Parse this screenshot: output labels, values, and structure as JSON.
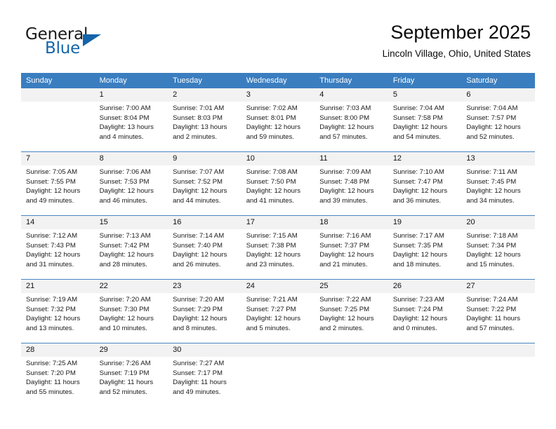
{
  "logo": {
    "word_one": "General",
    "word_two": "Blue",
    "icon": "triangle-logo-mark"
  },
  "header": {
    "month_title": "September 2025",
    "location": "Lincoln Village, Ohio, United States"
  },
  "colors": {
    "header_blue": "#3a7ec0",
    "row_divider": "#4a86c4",
    "daynum_band": "#f2f2f2",
    "logo_blue": "#1464aa"
  },
  "weekday_headers": [
    "Sunday",
    "Monday",
    "Tuesday",
    "Wednesday",
    "Thursday",
    "Friday",
    "Saturday"
  ],
  "weeks": [
    [
      {
        "day": "",
        "empty": true,
        "sunrise": "",
        "sunset": "",
        "daylight_line1": "",
        "daylight_line2": ""
      },
      {
        "day": "1",
        "sunrise": "Sunrise: 7:00 AM",
        "sunset": "Sunset: 8:04 PM",
        "daylight_line1": "Daylight: 13 hours",
        "daylight_line2": "and 4 minutes."
      },
      {
        "day": "2",
        "sunrise": "Sunrise: 7:01 AM",
        "sunset": "Sunset: 8:03 PM",
        "daylight_line1": "Daylight: 13 hours",
        "daylight_line2": "and 2 minutes."
      },
      {
        "day": "3",
        "sunrise": "Sunrise: 7:02 AM",
        "sunset": "Sunset: 8:01 PM",
        "daylight_line1": "Daylight: 12 hours",
        "daylight_line2": "and 59 minutes."
      },
      {
        "day": "4",
        "sunrise": "Sunrise: 7:03 AM",
        "sunset": "Sunset: 8:00 PM",
        "daylight_line1": "Daylight: 12 hours",
        "daylight_line2": "and 57 minutes."
      },
      {
        "day": "5",
        "sunrise": "Sunrise: 7:04 AM",
        "sunset": "Sunset: 7:58 PM",
        "daylight_line1": "Daylight: 12 hours",
        "daylight_line2": "and 54 minutes."
      },
      {
        "day": "6",
        "sunrise": "Sunrise: 7:04 AM",
        "sunset": "Sunset: 7:57 PM",
        "daylight_line1": "Daylight: 12 hours",
        "daylight_line2": "and 52 minutes."
      }
    ],
    [
      {
        "day": "7",
        "sunrise": "Sunrise: 7:05 AM",
        "sunset": "Sunset: 7:55 PM",
        "daylight_line1": "Daylight: 12 hours",
        "daylight_line2": "and 49 minutes."
      },
      {
        "day": "8",
        "sunrise": "Sunrise: 7:06 AM",
        "sunset": "Sunset: 7:53 PM",
        "daylight_line1": "Daylight: 12 hours",
        "daylight_line2": "and 46 minutes."
      },
      {
        "day": "9",
        "sunrise": "Sunrise: 7:07 AM",
        "sunset": "Sunset: 7:52 PM",
        "daylight_line1": "Daylight: 12 hours",
        "daylight_line2": "and 44 minutes."
      },
      {
        "day": "10",
        "sunrise": "Sunrise: 7:08 AM",
        "sunset": "Sunset: 7:50 PM",
        "daylight_line1": "Daylight: 12 hours",
        "daylight_line2": "and 41 minutes."
      },
      {
        "day": "11",
        "sunrise": "Sunrise: 7:09 AM",
        "sunset": "Sunset: 7:48 PM",
        "daylight_line1": "Daylight: 12 hours",
        "daylight_line2": "and 39 minutes."
      },
      {
        "day": "12",
        "sunrise": "Sunrise: 7:10 AM",
        "sunset": "Sunset: 7:47 PM",
        "daylight_line1": "Daylight: 12 hours",
        "daylight_line2": "and 36 minutes."
      },
      {
        "day": "13",
        "sunrise": "Sunrise: 7:11 AM",
        "sunset": "Sunset: 7:45 PM",
        "daylight_line1": "Daylight: 12 hours",
        "daylight_line2": "and 34 minutes."
      }
    ],
    [
      {
        "day": "14",
        "sunrise": "Sunrise: 7:12 AM",
        "sunset": "Sunset: 7:43 PM",
        "daylight_line1": "Daylight: 12 hours",
        "daylight_line2": "and 31 minutes."
      },
      {
        "day": "15",
        "sunrise": "Sunrise: 7:13 AM",
        "sunset": "Sunset: 7:42 PM",
        "daylight_line1": "Daylight: 12 hours",
        "daylight_line2": "and 28 minutes."
      },
      {
        "day": "16",
        "sunrise": "Sunrise: 7:14 AM",
        "sunset": "Sunset: 7:40 PM",
        "daylight_line1": "Daylight: 12 hours",
        "daylight_line2": "and 26 minutes."
      },
      {
        "day": "17",
        "sunrise": "Sunrise: 7:15 AM",
        "sunset": "Sunset: 7:38 PM",
        "daylight_line1": "Daylight: 12 hours",
        "daylight_line2": "and 23 minutes."
      },
      {
        "day": "18",
        "sunrise": "Sunrise: 7:16 AM",
        "sunset": "Sunset: 7:37 PM",
        "daylight_line1": "Daylight: 12 hours",
        "daylight_line2": "and 21 minutes."
      },
      {
        "day": "19",
        "sunrise": "Sunrise: 7:17 AM",
        "sunset": "Sunset: 7:35 PM",
        "daylight_line1": "Daylight: 12 hours",
        "daylight_line2": "and 18 minutes."
      },
      {
        "day": "20",
        "sunrise": "Sunrise: 7:18 AM",
        "sunset": "Sunset: 7:34 PM",
        "daylight_line1": "Daylight: 12 hours",
        "daylight_line2": "and 15 minutes."
      }
    ],
    [
      {
        "day": "21",
        "sunrise": "Sunrise: 7:19 AM",
        "sunset": "Sunset: 7:32 PM",
        "daylight_line1": "Daylight: 12 hours",
        "daylight_line2": "and 13 minutes."
      },
      {
        "day": "22",
        "sunrise": "Sunrise: 7:20 AM",
        "sunset": "Sunset: 7:30 PM",
        "daylight_line1": "Daylight: 12 hours",
        "daylight_line2": "and 10 minutes."
      },
      {
        "day": "23",
        "sunrise": "Sunrise: 7:20 AM",
        "sunset": "Sunset: 7:29 PM",
        "daylight_line1": "Daylight: 12 hours",
        "daylight_line2": "and 8 minutes."
      },
      {
        "day": "24",
        "sunrise": "Sunrise: 7:21 AM",
        "sunset": "Sunset: 7:27 PM",
        "daylight_line1": "Daylight: 12 hours",
        "daylight_line2": "and 5 minutes."
      },
      {
        "day": "25",
        "sunrise": "Sunrise: 7:22 AM",
        "sunset": "Sunset: 7:25 PM",
        "daylight_line1": "Daylight: 12 hours",
        "daylight_line2": "and 2 minutes."
      },
      {
        "day": "26",
        "sunrise": "Sunrise: 7:23 AM",
        "sunset": "Sunset: 7:24 PM",
        "daylight_line1": "Daylight: 12 hours",
        "daylight_line2": "and 0 minutes."
      },
      {
        "day": "27",
        "sunrise": "Sunrise: 7:24 AM",
        "sunset": "Sunset: 7:22 PM",
        "daylight_line1": "Daylight: 11 hours",
        "daylight_line2": "and 57 minutes."
      }
    ],
    [
      {
        "day": "28",
        "sunrise": "Sunrise: 7:25 AM",
        "sunset": "Sunset: 7:20 PM",
        "daylight_line1": "Daylight: 11 hours",
        "daylight_line2": "and 55 minutes."
      },
      {
        "day": "29",
        "sunrise": "Sunrise: 7:26 AM",
        "sunset": "Sunset: 7:19 PM",
        "daylight_line1": "Daylight: 11 hours",
        "daylight_line2": "and 52 minutes."
      },
      {
        "day": "30",
        "sunrise": "Sunrise: 7:27 AM",
        "sunset": "Sunset: 7:17 PM",
        "daylight_line1": "Daylight: 11 hours",
        "daylight_line2": "and 49 minutes."
      },
      {
        "day": "",
        "empty": true,
        "sunrise": "",
        "sunset": "",
        "daylight_line1": "",
        "daylight_line2": ""
      },
      {
        "day": "",
        "empty": true,
        "sunrise": "",
        "sunset": "",
        "daylight_line1": "",
        "daylight_line2": ""
      },
      {
        "day": "",
        "empty": true,
        "sunrise": "",
        "sunset": "",
        "daylight_line1": "",
        "daylight_line2": ""
      },
      {
        "day": "",
        "empty": true,
        "sunrise": "",
        "sunset": "",
        "daylight_line1": "",
        "daylight_line2": ""
      }
    ]
  ]
}
